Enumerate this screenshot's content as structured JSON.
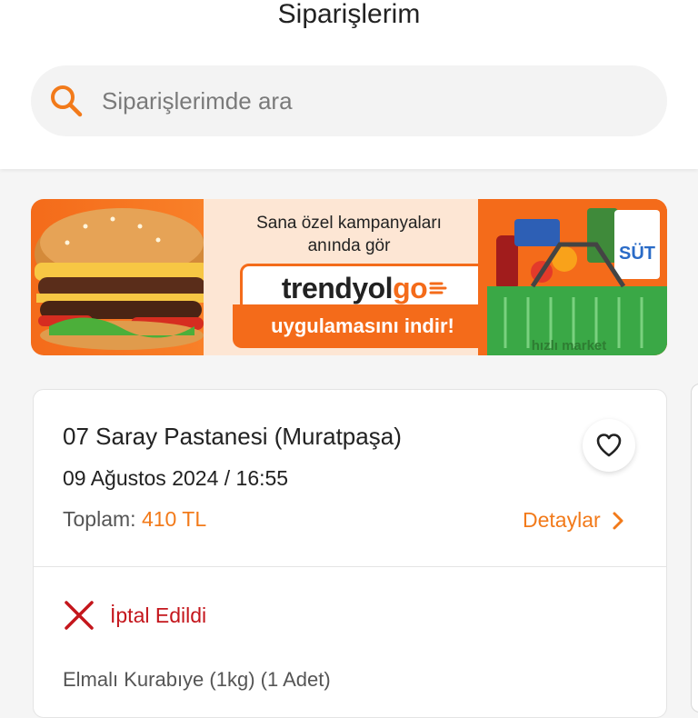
{
  "header": {
    "title": "Siparişlerim",
    "search_placeholder": "Siparişlerimde ara"
  },
  "banner": {
    "line1": "Sana özel kampanyaları",
    "line2": "anında gör",
    "brand_main": "trendyol",
    "brand_suffix": "go",
    "cta": "uygulamasını indir!",
    "milk_label": "SÜT",
    "basket_label": "hızlı market"
  },
  "order": {
    "store": "07 Saray Pastanesi (Muratpaşa)",
    "date": "09 Ağustos 2024 / 16:55",
    "total_label": "Toplam:",
    "total_value": "410 TL",
    "details_label": "Detaylar",
    "status": "İptal Edildi",
    "item": "Elmalı Kurabıye (1kg) (1 Adet)"
  },
  "colors": {
    "accent": "#f27a1a",
    "status_cancelled": "#c4161c"
  },
  "icons": {
    "search": "search-icon",
    "favorite": "heart-icon",
    "details": "chevron-right-icon",
    "status": "cross-icon"
  }
}
